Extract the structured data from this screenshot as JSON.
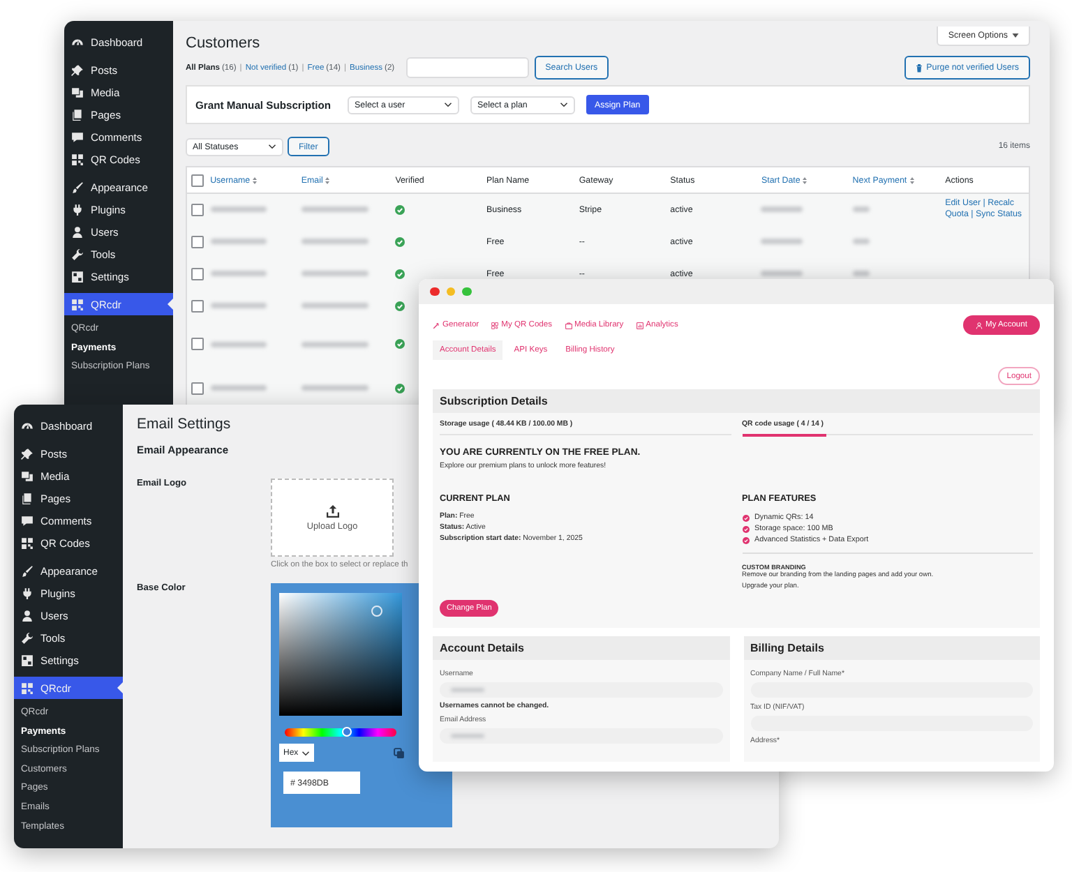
{
  "customers_window": {
    "sidebar": {
      "items": [
        {
          "label": "Dashboard",
          "selected": false
        },
        {
          "label": "Posts",
          "selected": false
        },
        {
          "label": "Media",
          "selected": false
        },
        {
          "label": "Pages",
          "selected": false
        },
        {
          "label": "Comments",
          "selected": false
        },
        {
          "label": "QR Codes",
          "selected": false
        },
        {
          "label": "Appearance",
          "selected": false
        },
        {
          "label": "Plugins",
          "selected": false
        },
        {
          "label": "Users",
          "selected": false
        },
        {
          "label": "Tools",
          "selected": false
        },
        {
          "label": "Settings",
          "selected": false
        },
        {
          "label": "QRcdr",
          "selected": true
        }
      ],
      "submenu": [
        {
          "label": "QRcdr",
          "selected": false
        },
        {
          "label": "Payments",
          "selected": true
        },
        {
          "label": "Subscription Plans",
          "selected": false
        }
      ]
    },
    "title": "Customers",
    "screen_options": "Screen Options",
    "filters": [
      {
        "label": "All Plans",
        "count": "(16)",
        "selected": true
      },
      {
        "prefix": "|",
        "label": "Not verified",
        "count": "(1)",
        "selected": false
      },
      {
        "prefix": "|",
        "label": "Free",
        "count": "(14)",
        "selected": false
      },
      {
        "prefix": "|",
        "label": "Business",
        "count": "(2)",
        "selected": false
      }
    ],
    "search_button": "Search Users",
    "purge_button": "Purge not verified Users",
    "grant": {
      "title": "Grant Manual Subscription",
      "user_select": "Select a user",
      "plan_select": "Select a plan",
      "button": "Assign Plan"
    },
    "status_select": "All Statuses",
    "filter_button": "Filter",
    "item_count": "16 items",
    "table": {
      "select_all_checked": false,
      "columns": [
        {
          "label": "Username",
          "sortable": true
        },
        {
          "label": "Email",
          "sortable": true
        },
        {
          "label": "Verified",
          "sortable": false
        },
        {
          "label": "Plan Name",
          "sortable": false
        },
        {
          "label": "Gateway",
          "sortable": false
        },
        {
          "label": "Status",
          "sortable": false
        },
        {
          "label": "Start Date",
          "sortable": true
        },
        {
          "label": "Next Payment",
          "sortable": true
        },
        {
          "label": "Actions",
          "sortable": false
        }
      ],
      "rows": [
        {
          "checked": false,
          "verified": true,
          "plan": "Business",
          "gateway": "Stripe",
          "status": "active",
          "actions": "Edit User | Recalc Quota | Sync Status"
        },
        {
          "checked": false,
          "verified": true,
          "plan": "Free",
          "gateway": "--",
          "status": "active"
        },
        {
          "checked": false,
          "verified": true,
          "plan": "Free",
          "gateway": "--",
          "status": "active"
        },
        {
          "checked": false,
          "verified": true
        },
        {
          "checked": false,
          "verified": true
        },
        {
          "checked": false,
          "verified": true
        }
      ]
    }
  },
  "email_window": {
    "sidebar": {
      "items": [
        {
          "label": "Dashboard",
          "selected": false
        },
        {
          "label": "Posts",
          "selected": false
        },
        {
          "label": "Media",
          "selected": false
        },
        {
          "label": "Pages",
          "selected": false
        },
        {
          "label": "Comments",
          "selected": false
        },
        {
          "label": "QR Codes",
          "selected": false
        },
        {
          "label": "Appearance",
          "selected": false
        },
        {
          "label": "Plugins",
          "selected": false
        },
        {
          "label": "Users",
          "selected": false
        },
        {
          "label": "Tools",
          "selected": false
        },
        {
          "label": "Settings",
          "selected": false
        },
        {
          "label": "QRcdr",
          "selected": true
        }
      ],
      "submenu": [
        {
          "label": "QRcdr",
          "selected": false
        },
        {
          "label": "Payments",
          "selected": true
        },
        {
          "label": "Subscription Plans",
          "selected": false
        },
        {
          "label": "Customers",
          "selected": false
        },
        {
          "label": "Pages",
          "selected": false
        },
        {
          "label": "Emails",
          "selected": false
        },
        {
          "label": "Templates",
          "selected": false
        }
      ]
    },
    "title": "Email Settings",
    "section": "Email Appearance",
    "logo_label": "Email Logo",
    "upload_label": "Upload Logo",
    "upload_hint": "Click on the box to select or replace th",
    "color_label": "Base Color",
    "picker": {
      "hue_slider": {
        "level": 0.56
      },
      "format": "Hex",
      "value": "# 3498DB"
    }
  },
  "account_window": {
    "nav": [
      {
        "label": "Generator"
      },
      {
        "label": "My QR Codes"
      },
      {
        "label": "Media Library"
      },
      {
        "label": "Analytics"
      }
    ],
    "account_button": "My Account",
    "subnav": [
      {
        "label": "Account Details",
        "selected": true
      },
      {
        "label": "API Keys",
        "selected": false
      },
      {
        "label": "Billing History",
        "selected": false
      }
    ],
    "logout": "Logout",
    "subscription": {
      "title": "Subscription Details",
      "usage": [
        {
          "label": "Storage usage ( 48.44 KB / 100.00 MB )",
          "level": 0
        },
        {
          "label": "QR code usage ( 4 / 14 )",
          "level": 0.29
        }
      ],
      "headline": "YOU ARE CURRENTLY ON THE FREE PLAN.",
      "subline": "Explore our premium plans to unlock more features!",
      "current_plan": {
        "title": "CURRENT PLAN",
        "lines": [
          "**Plan:** Free",
          "**Status:** Active",
          "**Subscription start date:** November 1, 2025"
        ]
      },
      "features": {
        "title": "PLAN FEATURES",
        "items": [
          "Dynamic QRs: 14",
          "Storage space: 100 MB",
          "Advanced Statistics + Data Export"
        ]
      },
      "branding": {
        "title": "CUSTOM BRANDING",
        "lines": [
          "Remove our branding from the landing pages and add your own.",
          "Upgrade your plan."
        ]
      },
      "change_button": "Change Plan"
    },
    "account_details": {
      "title": "Account Details",
      "fields": [
        {
          "label": "Username",
          "input": true,
          "value_hidden": true,
          "note": "Usernames cannot be changed."
        },
        {
          "label": "Email Address",
          "input": true,
          "value_hidden": true
        }
      ]
    },
    "billing_details": {
      "title": "Billing Details",
      "fields": [
        {
          "label": "Company Name / Full Name*",
          "input": true,
          "value_hidden": false
        },
        {
          "label": "Tax ID (NIF/VAT)",
          "input": true,
          "value_hidden": false
        },
        {
          "label": "Address*",
          "input": false
        }
      ]
    }
  }
}
